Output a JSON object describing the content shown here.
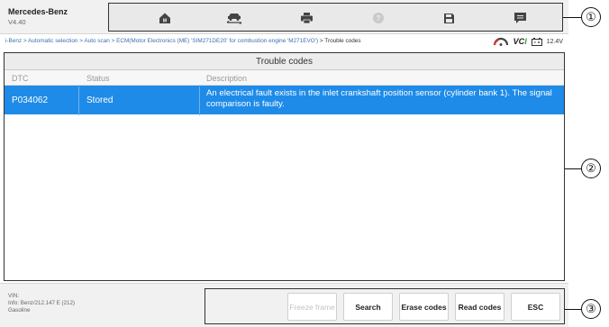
{
  "app": {
    "title": "Mercedes-Benz",
    "version": "V4.40"
  },
  "toolbar": {
    "icons": [
      "home-icon",
      "vehicle-swap-icon",
      "print-icon",
      "help-icon",
      "save-icon",
      "message-icon"
    ]
  },
  "breadcrumb": {
    "path": "i-Benz > Automatic selection > Auto scan > ECM(Motor Electronics (ME) 'SIM271DE20' for combustion engine 'M271EVO')",
    "tail": "> Trouble codes"
  },
  "status": {
    "vci_label_1": "VC",
    "vci_label_2": "I",
    "voltage": "12.4V"
  },
  "panel": {
    "title": "Trouble codes",
    "columns": [
      "DTC",
      "Status",
      "Description"
    ],
    "rows": [
      {
        "dtc": "P034062",
        "status": "Stored",
        "description": "An electrical fault exists in the inlet crankshaft position sensor (cylinder bank 1). The signal comparison is faulty."
      }
    ]
  },
  "footer": {
    "vin_label": "VIN:",
    "info": "Info: Benz/212.147 E (212)",
    "fuel": "Gasoline",
    "buttons": {
      "freeze_frame": "Freeze frame",
      "search": "Search",
      "erase_codes": "Erase codes",
      "read_codes": "Read codes",
      "esc": "ESC"
    }
  },
  "callouts": [
    "①",
    "②",
    "③"
  ],
  "colors": {
    "selected_row": "#1f8be8",
    "link": "#3a6fb5",
    "vci_green": "#2e9e3c"
  }
}
